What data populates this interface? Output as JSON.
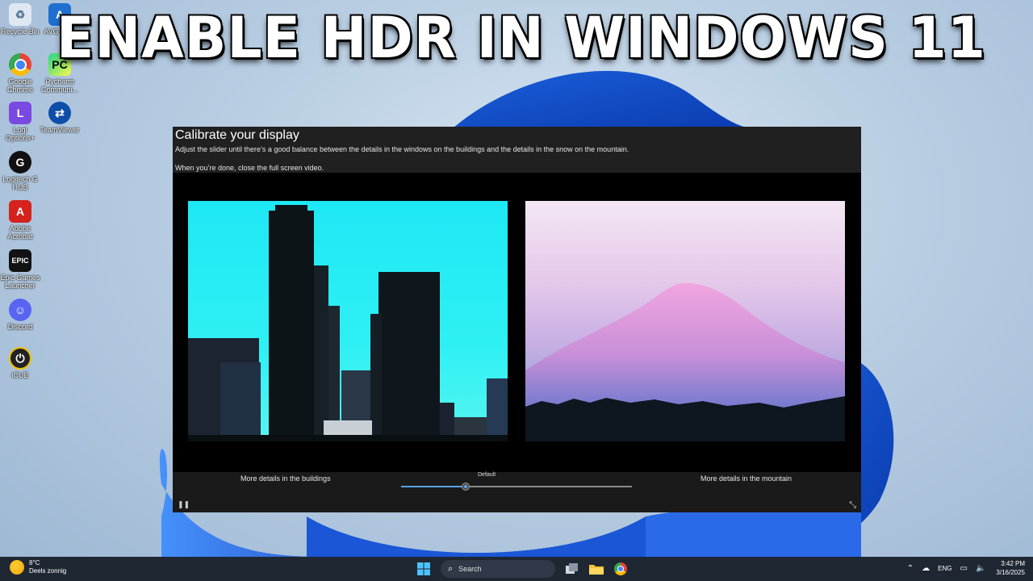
{
  "headline": "ENABLE HDR IN WINDOWS 11",
  "desktop_icons": [
    {
      "label": "Recycle Bin",
      "icon": "recycle-bin-icon"
    },
    {
      "label": "AVG Se...",
      "icon": "avg-icon"
    },
    {
      "label": "Google Chrome",
      "icon": "chrome-icon"
    },
    {
      "label": "Pycharm Communi...",
      "icon": "pycharm-icon"
    },
    {
      "label": "Logi Options+",
      "icon": "logi-options-icon"
    },
    {
      "label": "TeamViewer",
      "icon": "teamviewer-icon"
    },
    {
      "label": "Logitech G HUB",
      "icon": "logitech-ghub-icon"
    },
    {
      "label": "Adobe Acrobat",
      "icon": "adobe-acrobat-icon"
    },
    {
      "label": "Epic Games Launcher",
      "icon": "epic-games-icon"
    },
    {
      "label": "Discord",
      "icon": "discord-icon"
    },
    {
      "label": "iCUE",
      "icon": "icue-icon"
    }
  ],
  "calibration": {
    "title": "Calibrate your display",
    "instruction": "Adjust the slider until there’s a good balance between the details in the windows on the buildings and the details in the snow on the mountain.",
    "close_hint": "When you’re done, close the full screen video.",
    "left_label": "More details in the buildings",
    "right_label": "More details in the mountain",
    "slider_label": "Default",
    "slider_value": 0.28
  },
  "taskbar": {
    "weather_temp": "8°C",
    "weather_desc": "Deels zonnig",
    "search_placeholder": "Search",
    "language": "ENG",
    "time": "3:42 PM",
    "date": "3/16/2025"
  },
  "colors": {
    "taskbar_bg": "#1f2733",
    "slider_accent": "#5aa3e8",
    "sky_cyan": "#1ee8f5"
  }
}
